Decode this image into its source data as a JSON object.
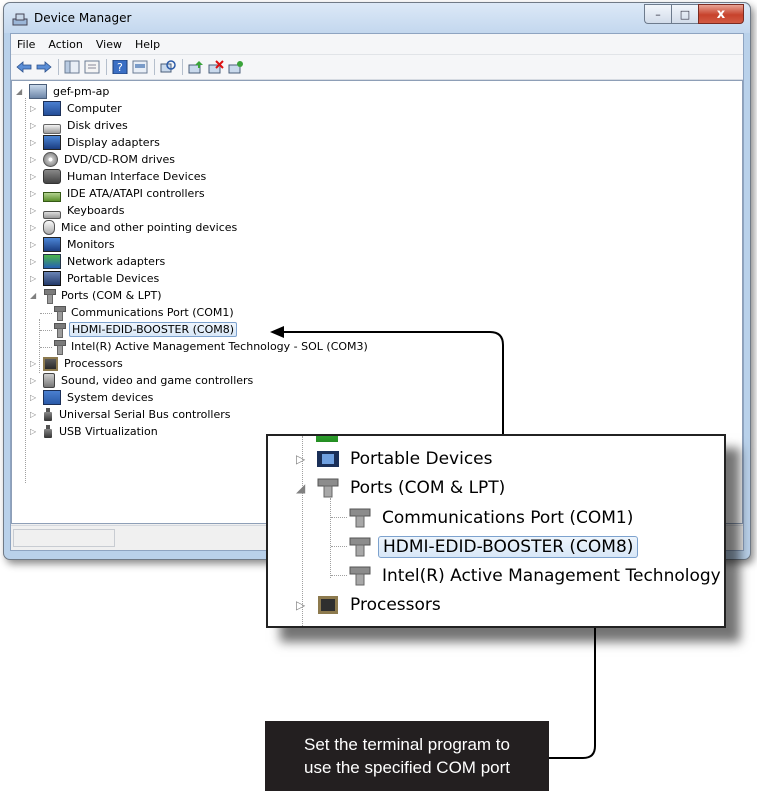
{
  "window": {
    "title": "Device Manager",
    "caption_buttons": {
      "minimize": "–",
      "maximize": "□",
      "close": "x"
    }
  },
  "menu": [
    "File",
    "Action",
    "View",
    "Help"
  ],
  "toolbar": {
    "icons": [
      "back-arrow-icon",
      "forward-arrow-icon",
      "console-tree-icon",
      "properties-icon",
      "help-icon",
      "show-hidden-icon",
      "scan-changes-icon",
      "update-driver-icon",
      "uninstall-icon",
      "enable-device-icon"
    ]
  },
  "tree": {
    "root": "gef-pm-ap",
    "categories": [
      {
        "label": "Computer",
        "icon": "computer-icon"
      },
      {
        "label": "Disk drives",
        "icon": "disk-drive-icon"
      },
      {
        "label": "Display adapters",
        "icon": "display-adapter-icon"
      },
      {
        "label": "DVD/CD-ROM drives",
        "icon": "dvd-icon"
      },
      {
        "label": "Human Interface Devices",
        "icon": "hid-icon"
      },
      {
        "label": "IDE ATA/ATAPI controllers",
        "icon": "ide-controller-icon"
      },
      {
        "label": "Keyboards",
        "icon": "keyboard-icon"
      },
      {
        "label": "Mice and other pointing devices",
        "icon": "mouse-icon"
      },
      {
        "label": "Monitors",
        "icon": "monitor-icon"
      },
      {
        "label": "Network adapters",
        "icon": "network-adapter-icon"
      },
      {
        "label": "Portable Devices",
        "icon": "portable-device-icon"
      },
      {
        "label": "Ports (COM & LPT)",
        "icon": "port-icon",
        "expanded": true,
        "children": [
          {
            "label": "Communications Port (COM1)",
            "icon": "port-icon"
          },
          {
            "label": "HDMI-EDID-BOOSTER (COM8)",
            "icon": "port-icon",
            "selected": true
          },
          {
            "label": "Intel(R) Active Management Technology - SOL (COM3)",
            "icon": "port-icon"
          }
        ]
      },
      {
        "label": "Processors",
        "icon": "processor-icon"
      },
      {
        "label": "Sound, video and game controllers",
        "icon": "sound-icon"
      },
      {
        "label": "System devices",
        "icon": "system-device-icon"
      },
      {
        "label": "Universal Serial Bus controllers",
        "icon": "usb-icon"
      },
      {
        "label": "USB Virtualization",
        "icon": "usb-icon"
      }
    ]
  },
  "zoom": {
    "rows": [
      "Portable Devices",
      "Ports (COM & LPT)",
      "Communications Port (COM1)",
      "HDMI-EDID-BOOSTER (COM8)",
      "Intel(R) Active Management Technology",
      "Processors"
    ]
  },
  "callout": {
    "line1": "Set the terminal program to",
    "line2": "use the specified COM port"
  }
}
